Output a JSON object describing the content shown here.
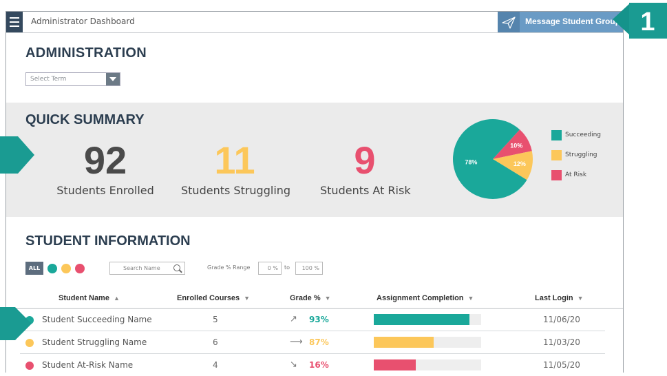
{
  "app": {
    "title": "Administrator Dashboard"
  },
  "message_button": {
    "label": "Message Student Group",
    "icon": "paper-plane-icon"
  },
  "administration": {
    "heading": "ADMINISTRATION",
    "term_select": {
      "placeholder": "Select Term"
    }
  },
  "summary": {
    "heading": "QUICK SUMMARY",
    "stats": [
      {
        "value": "92",
        "label": "Students Enrolled",
        "color": "#4a4a4a"
      },
      {
        "value": "11",
        "label": "Students Struggling",
        "color": "#fcc75a"
      },
      {
        "value": "9",
        "label": "Students At Risk",
        "color": "#e8506f"
      }
    ]
  },
  "chart_data": {
    "type": "pie",
    "slices": [
      {
        "name": "Succeeding",
        "value": 78,
        "label": "78%",
        "color": "#1aa89a"
      },
      {
        "name": "Struggling",
        "value": 12,
        "label": "12%",
        "color": "#fcc75a"
      },
      {
        "name": "At Risk",
        "value": 10,
        "label": "10%",
        "color": "#e8506f"
      }
    ],
    "legend": [
      "Succeeding",
      "Struggling",
      "At Risk"
    ],
    "legend_position": "right"
  },
  "student_info": {
    "heading": "STUDENT INFORMATION",
    "filters": {
      "all_label": "ALL",
      "dots": [
        "#1aa89a",
        "#fcc75a",
        "#e8506f"
      ],
      "search_placeholder": "Search Name",
      "grade_range_label": "Grade % Range",
      "range_from": "0 %",
      "range_to_label": "to",
      "range_to": "100 %"
    },
    "columns": [
      "Student Name",
      "Enrolled Courses",
      "Grade %",
      "Assignment Completion",
      "Last Login"
    ],
    "rows": [
      {
        "status_color": "#1aa89a",
        "name": "Student Succeeding Name",
        "courses": "5",
        "trend": "↗",
        "grade": "93%",
        "grade_color": "#1aa89a",
        "completion": 0.89,
        "bar_color": "#1aa89a",
        "last_login": "11/06/20"
      },
      {
        "status_color": "#fcc75a",
        "name": "Student Struggling Name",
        "courses": "6",
        "trend": "⟶",
        "grade": "87%",
        "grade_color": "#fcc75a",
        "completion": 0.56,
        "bar_color": "#fcc75a",
        "last_login": "11/03/20"
      },
      {
        "status_color": "#e8506f",
        "name": "Student At-Risk Name",
        "courses": "4",
        "trend": "↘",
        "grade": "16%",
        "grade_color": "#e8506f",
        "completion": 0.39,
        "bar_color": "#e8506f",
        "last_login": "11/05/20"
      }
    ]
  },
  "callouts": {
    "badge_1": "1"
  }
}
